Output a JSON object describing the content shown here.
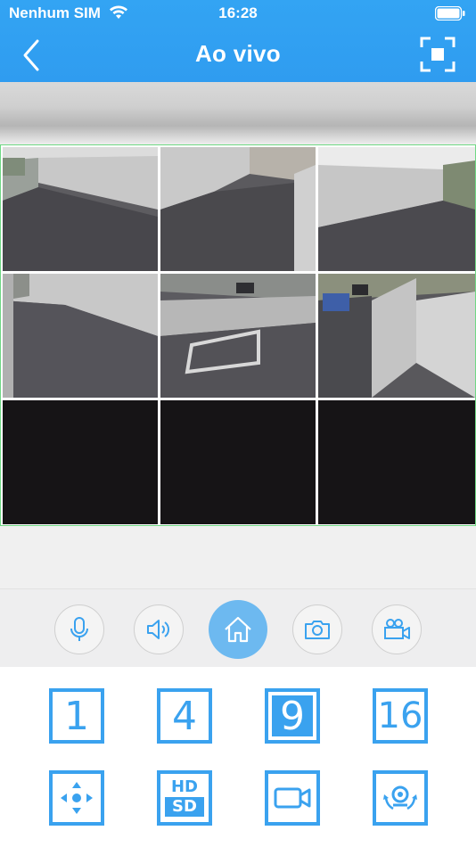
{
  "status_bar": {
    "carrier": "Nenhum SIM",
    "time": "16:28"
  },
  "nav": {
    "title": "Ao vivo",
    "back_icon": "chevron-left-icon",
    "action_icon": "fullscreen-icon"
  },
  "camera_grid": {
    "layout": "3x3",
    "cells": [
      {
        "channel": 1,
        "state": "live"
      },
      {
        "channel": 2,
        "state": "live"
      },
      {
        "channel": 3,
        "state": "live"
      },
      {
        "channel": 4,
        "state": "live"
      },
      {
        "channel": 5,
        "state": "live"
      },
      {
        "channel": 6,
        "state": "live"
      },
      {
        "channel": 7,
        "state": "empty"
      },
      {
        "channel": 8,
        "state": "empty"
      },
      {
        "channel": 9,
        "state": "empty"
      }
    ]
  },
  "controls": [
    {
      "icon": "microphone-icon"
    },
    {
      "icon": "speaker-icon"
    },
    {
      "icon": "home-icon"
    },
    {
      "icon": "camera-icon"
    },
    {
      "icon": "video-camera-icon"
    }
  ],
  "split_buttons": [
    {
      "label": "1"
    },
    {
      "label": "4"
    },
    {
      "label": "9",
      "selected": true
    },
    {
      "label": "16"
    }
  ],
  "tool_buttons": [
    {
      "icon": "ptz-arrows-icon"
    },
    {
      "icon": "hd-sd-icon",
      "hd": "HD",
      "sd": "SD"
    },
    {
      "icon": "record-icon"
    },
    {
      "icon": "rotate-camera-icon"
    }
  ],
  "colors": {
    "nav_blue": "#2f9cf0",
    "accent": "#3aa2ef",
    "grid_border": "#6fd884"
  }
}
